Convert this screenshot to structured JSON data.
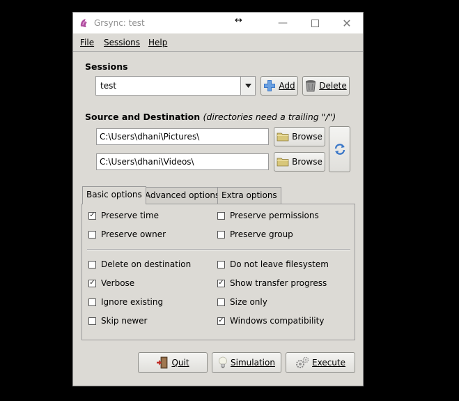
{
  "window": {
    "title": "Grsync: test"
  },
  "menu": {
    "file": "File",
    "sessions": "Sessions",
    "help": "Help"
  },
  "sessions": {
    "label": "Sessions",
    "selected": "test",
    "add_label": "Add",
    "delete_label": "Delete"
  },
  "source_dest": {
    "label": "Source and Destination",
    "hint": "(directories need a trailing \"/\")",
    "source": "C:\\Users\\dhani\\Pictures\\",
    "destination": "C:\\Users\\dhani\\Videos\\",
    "browse_label": "Browse"
  },
  "tabs": [
    {
      "label": "Basic options",
      "active": true
    },
    {
      "label": "Advanced options",
      "active": false
    },
    {
      "label": "Extra options",
      "active": false
    }
  ],
  "options": {
    "preserve_time": {
      "label": "Preserve time",
      "checked": true
    },
    "preserve_permissions": {
      "label": "Preserve permissions",
      "checked": false
    },
    "preserve_owner": {
      "label": "Preserve owner",
      "checked": false
    },
    "preserve_group": {
      "label": "Preserve group",
      "checked": false
    },
    "delete_on_destination": {
      "label": "Delete on destination",
      "checked": false
    },
    "do_not_leave_filesystem": {
      "label": "Do not leave filesystem",
      "checked": false
    },
    "verbose": {
      "label": "Verbose",
      "checked": true
    },
    "show_transfer_progress": {
      "label": "Show transfer progress",
      "checked": true
    },
    "ignore_existing": {
      "label": "Ignore existing",
      "checked": false
    },
    "size_only": {
      "label": "Size only",
      "checked": false
    },
    "skip_newer": {
      "label": "Skip newer",
      "checked": false
    },
    "windows_compatibility": {
      "label": "Windows compatibility",
      "checked": true
    }
  },
  "actions": {
    "quit": "Quit",
    "simulation": "Simulation",
    "execute": "Execute"
  },
  "colors": {
    "window_bg": "#dcdad5",
    "accent_blue": "#3c78c8"
  }
}
